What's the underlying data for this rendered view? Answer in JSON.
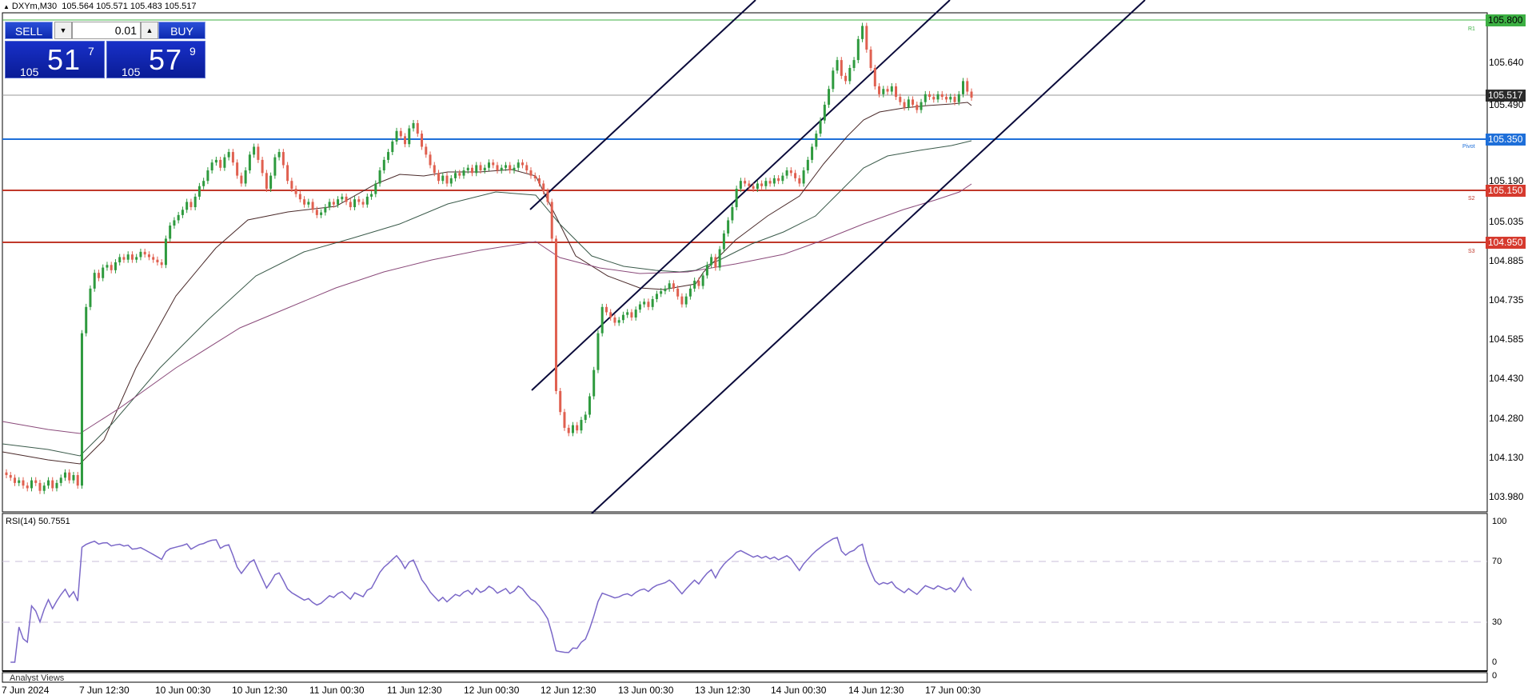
{
  "header": {
    "symbol_info": "DXYm,M30",
    "ohlc": "105.564 105.571 105.483 105.517"
  },
  "trade_panel": {
    "sell_label": "SELL",
    "buy_label": "BUY",
    "lot_value": "0.01",
    "sell_price_big": "105",
    "sell_price_main": "51",
    "sell_price_sup": "7",
    "buy_price_big": "105",
    "buy_price_main": "57",
    "buy_price_sup": "9"
  },
  "levels": {
    "r1": {
      "label": "R1",
      "price": "105.800",
      "color": "#3cb043"
    },
    "pivot": {
      "label": "Pivot",
      "price": "105.350",
      "color": "#1e6fd9"
    },
    "s2": {
      "label": "S2",
      "price": "105.150",
      "color": "#c0392b"
    },
    "s3": {
      "label": "S3",
      "price": "104.950",
      "color": "#c0392b"
    },
    "current": {
      "price": "105.517",
      "color": "#2b2b2b"
    }
  },
  "rsi": {
    "title": "RSI(14) 50.7551",
    "ticks": [
      "100",
      "70",
      "30",
      "0"
    ]
  },
  "analyst_label": "Analyst Views",
  "bottom_tick": "0",
  "colors": {
    "bull": "#2e9a3e",
    "bear": "#e06050",
    "rsi": "#7b68c8",
    "channel": "#0a0a3a"
  },
  "chart_data": {
    "type": "candlestick",
    "instrument": "DXYm",
    "timeframe": "M30",
    "x_labels": [
      "7 Jun 2024",
      "7 Jun 12:30",
      "10 Jun 00:30",
      "10 Jun 12:30",
      "11 Jun 00:30",
      "11 Jun 12:30",
      "12 Jun 00:30",
      "12 Jun 12:30",
      "13 Jun 00:30",
      "13 Jun 12:30",
      "14 Jun 00:30",
      "14 Jun 12:30",
      "17 Jun 00:30"
    ],
    "y_ticks": [
      "105.640",
      "105.490",
      "105.190",
      "105.035",
      "104.885",
      "104.735",
      "104.585",
      "104.430",
      "104.280",
      "104.130",
      "103.980"
    ],
    "ylim": [
      103.94,
      105.84
    ],
    "close_series": [
      104.08,
      104.07,
      104.05,
      104.06,
      104.04,
      104.03,
      104.06,
      104.05,
      104.02,
      104.04,
      104.06,
      104.03,
      104.05,
      104.07,
      104.09,
      104.06,
      104.08,
      104.04,
      104.62,
      104.72,
      104.79,
      104.85,
      104.83,
      104.87,
      104.88,
      104.86,
      104.89,
      104.91,
      104.9,
      104.92,
      104.9,
      104.91,
      104.93,
      104.92,
      104.91,
      104.9,
      104.89,
      104.88,
      104.98,
      105.03,
      105.05,
      105.07,
      105.09,
      105.12,
      105.1,
      105.14,
      105.18,
      105.2,
      105.24,
      105.27,
      105.28,
      105.25,
      105.29,
      105.31,
      105.27,
      105.22,
      105.19,
      105.24,
      105.3,
      105.33,
      105.28,
      105.23,
      105.17,
      105.22,
      105.29,
      105.31,
      105.26,
      105.2,
      105.17,
      105.15,
      105.13,
      105.11,
      105.12,
      105.09,
      105.07,
      105.08,
      105.1,
      105.12,
      105.11,
      105.13,
      105.14,
      105.12,
      105.1,
      105.13,
      105.12,
      105.11,
      105.14,
      105.15,
      105.19,
      105.24,
      105.28,
      105.31,
      105.35,
      105.39,
      105.37,
      105.34,
      105.4,
      105.42,
      105.38,
      105.33,
      105.3,
      105.26,
      105.23,
      105.2,
      105.22,
      105.19,
      105.21,
      105.23,
      105.22,
      105.24,
      105.25,
      105.23,
      105.26,
      105.24,
      105.25,
      105.27,
      105.26,
      105.24,
      105.25,
      105.26,
      105.24,
      105.25,
      105.27,
      105.26,
      105.24,
      105.22,
      105.21,
      105.19,
      105.16,
      105.12,
      104.98,
      104.4,
      104.32,
      104.26,
      104.24,
      104.27,
      104.25,
      104.29,
      104.31,
      104.38,
      104.48,
      104.62,
      104.72,
      104.7,
      104.68,
      104.66,
      104.67,
      104.69,
      104.7,
      104.68,
      104.71,
      104.73,
      104.74,
      104.72,
      104.75,
      104.77,
      104.78,
      104.79,
      104.81,
      104.79,
      104.76,
      104.73,
      104.76,
      104.79,
      104.82,
      104.8,
      104.84,
      104.88,
      104.91,
      104.87,
      104.94,
      105.0,
      105.05,
      105.1,
      105.17,
      105.2,
      105.19,
      105.18,
      105.17,
      105.19,
      105.18,
      105.2,
      105.19,
      105.21,
      105.2,
      105.22,
      105.24,
      105.23,
      105.21,
      105.19,
      105.24,
      105.28,
      105.33,
      105.38,
      105.43,
      105.49,
      105.55,
      105.62,
      105.66,
      105.6,
      105.58,
      105.63,
      105.66,
      105.74,
      105.79,
      105.7,
      105.63,
      105.56,
      105.53,
      105.55,
      105.54,
      105.56,
      105.52,
      105.5,
      105.48,
      105.51,
      105.49,
      105.47,
      105.5,
      105.53,
      105.52,
      105.51,
      105.53,
      105.52,
      105.51,
      105.52,
      105.5,
      105.53,
      105.58,
      105.54,
      105.517
    ]
  }
}
